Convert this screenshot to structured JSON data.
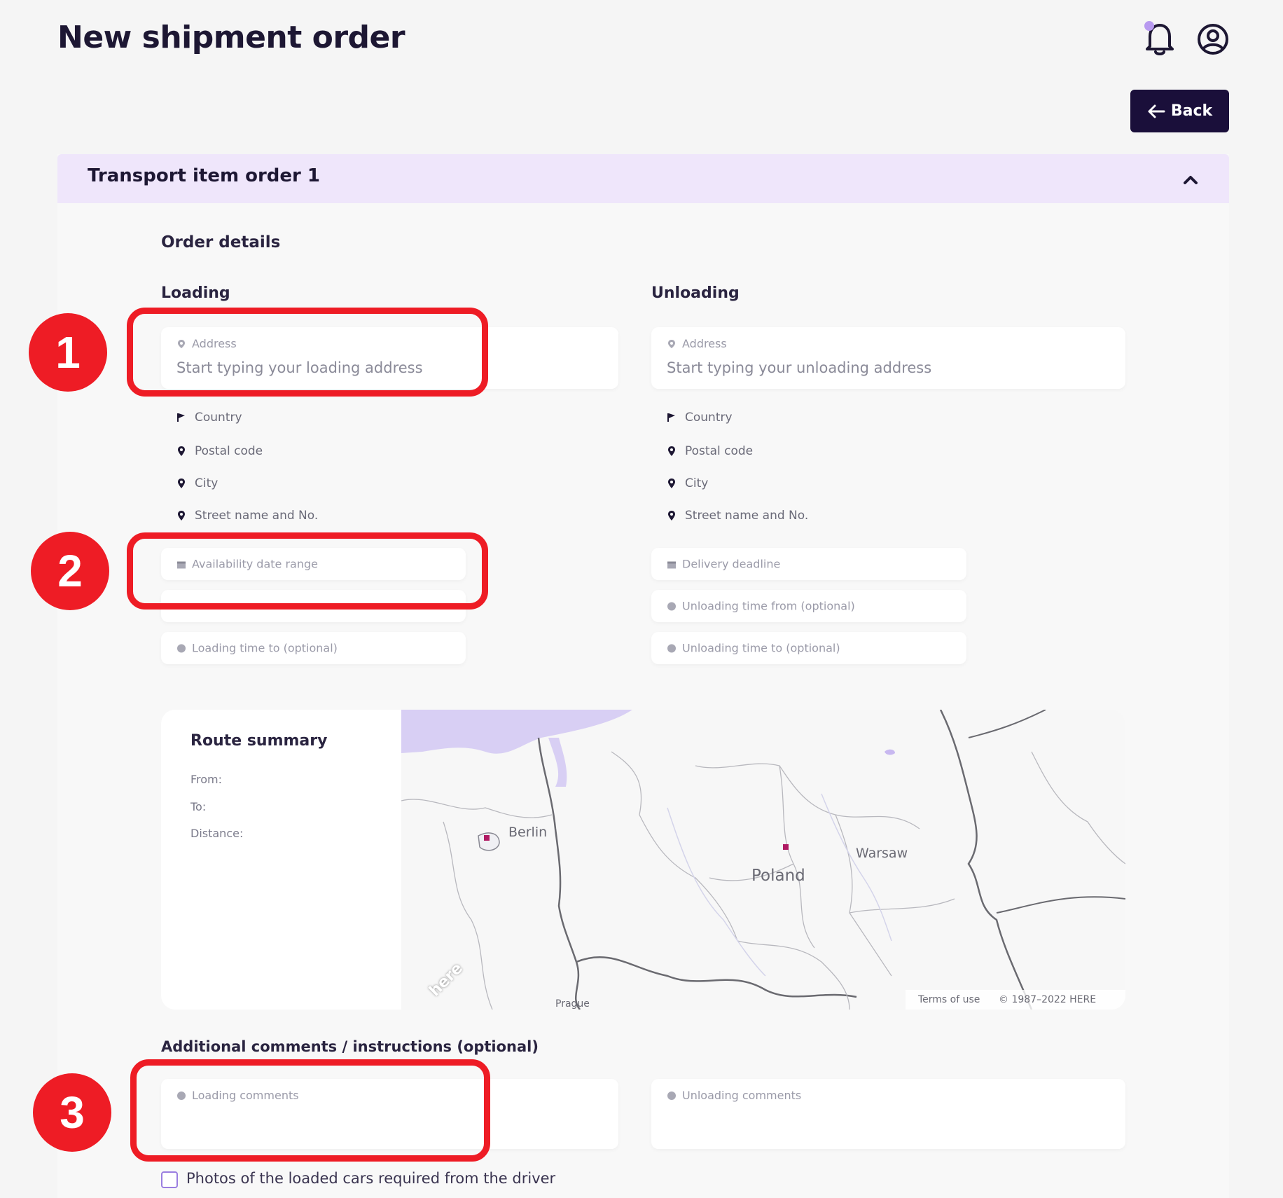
{
  "header": {
    "title": "New shipment order",
    "back_label": "Back"
  },
  "card": {
    "title": "Transport item order 1"
  },
  "order_details": {
    "title": "Order details",
    "loading": {
      "title": "Loading",
      "address_label": "Address",
      "address_placeholder": "Start typing your loading address",
      "country": "Country",
      "postal_code": "Postal code",
      "city": "City",
      "street": "Street name and No.",
      "date_range": "Availability date range",
      "time_to": "Loading time to (optional)"
    },
    "unloading": {
      "title": "Unloading",
      "address_label": "Address",
      "address_placeholder": "Start typing your unloading address",
      "country": "Country",
      "postal_code": "Postal code",
      "city": "City",
      "street": "Street name and No.",
      "deadline": "Delivery deadline",
      "time_from": "Unloading time from (optional)",
      "time_to": "Unloading time to (optional)"
    }
  },
  "route_summary": {
    "title": "Route summary",
    "from": "From:",
    "to": "To:",
    "distance": "Distance:",
    "map": {
      "berlin": "Berlin",
      "poland": "Poland",
      "warsaw": "Warsaw",
      "here_logo": "here",
      "terms": "Terms of use",
      "copyright": "© 1987–2022 HERE",
      "prague": "Prague"
    }
  },
  "comments": {
    "title": "Additional comments / instructions (optional)",
    "loading": "Loading comments",
    "unloading": "Unloading comments",
    "photos_checkbox": "Photos of the loaded cars required from the driver"
  },
  "annotations": {
    "badge1": "1",
    "badge2": "2",
    "badge3": "3"
  },
  "colors": {
    "primary": "#1a0f3a",
    "header_bg": "#efe6fb",
    "annotation_red": "#ee1c25",
    "accent": "#b89af0"
  }
}
